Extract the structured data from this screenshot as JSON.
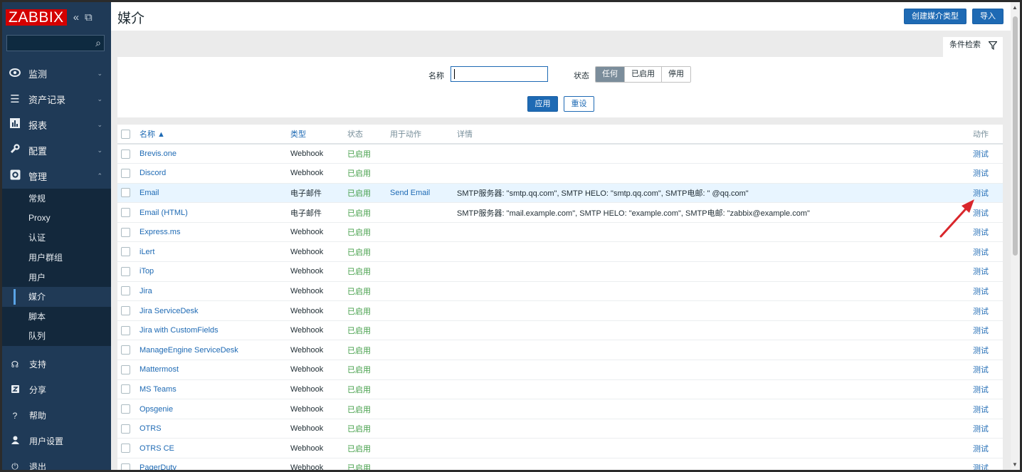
{
  "sidebar": {
    "logo": "ZABBIX",
    "collapse_icon": "«",
    "kiosk_icon": "⧉",
    "menu": [
      {
        "label": "监测",
        "icon": "👁"
      },
      {
        "label": "资产记录",
        "icon": "☰"
      },
      {
        "label": "报表",
        "icon": "▥"
      },
      {
        "label": "配置",
        "icon": "🔧"
      },
      {
        "label": "管理",
        "icon": "⚙"
      }
    ],
    "admin_submenu": [
      "常规",
      "Proxy",
      "认证",
      "用户群组",
      "用户",
      "媒介",
      "脚本",
      "队列"
    ],
    "active_submenu": "媒介",
    "bottom": [
      {
        "label": "支持",
        "icon": "?"
      },
      {
        "label": "分享",
        "icon": "Z"
      },
      {
        "label": "帮助",
        "icon": "?"
      },
      {
        "label": "用户设置",
        "icon": "👤"
      },
      {
        "label": "退出",
        "icon": "⏻"
      }
    ]
  },
  "header": {
    "title": "媒介",
    "create_button": "创建媒介类型",
    "import_button": "导入"
  },
  "filter": {
    "tab_label": "条件检索",
    "name_label": "名称",
    "name_value": "",
    "status_label": "状态",
    "status_options": [
      "任何",
      "已启用",
      "停用"
    ],
    "status_selected": "任何",
    "apply_button": "应用",
    "reset_button": "重设"
  },
  "table": {
    "headers": {
      "name": "名称 ▲",
      "type": "类型",
      "status": "状态",
      "used_in_actions": "用于动作",
      "details": "详情",
      "action": "动作"
    },
    "rows": [
      {
        "name": "Brevis.one",
        "type": "Webhook",
        "status": "已启用",
        "actions": "",
        "details": "",
        "test": "测试"
      },
      {
        "name": "Discord",
        "type": "Webhook",
        "status": "已启用",
        "actions": "",
        "details": "",
        "test": "测试"
      },
      {
        "name": "Email",
        "type": "电子邮件",
        "status": "已启用",
        "actions": "Send Email",
        "details": "SMTP服务器: \"smtp.qq.com\", SMTP HELO: \"smtp.qq.com\", SMTP电邮: \"          @qq.com\"",
        "test": "测试"
      },
      {
        "name": "Email (HTML)",
        "type": "电子邮件",
        "status": "已启用",
        "actions": "",
        "details": "SMTP服务器: \"mail.example.com\", SMTP HELO: \"example.com\", SMTP电邮: \"zabbix@example.com\"",
        "test": "测试"
      },
      {
        "name": "Express.ms",
        "type": "Webhook",
        "status": "已启用",
        "actions": "",
        "details": "",
        "test": "测试"
      },
      {
        "name": "iLert",
        "type": "Webhook",
        "status": "已启用",
        "actions": "",
        "details": "",
        "test": "测试"
      },
      {
        "name": "iTop",
        "type": "Webhook",
        "status": "已启用",
        "actions": "",
        "details": "",
        "test": "测试"
      },
      {
        "name": "Jira",
        "type": "Webhook",
        "status": "已启用",
        "actions": "",
        "details": "",
        "test": "测试"
      },
      {
        "name": "Jira ServiceDesk",
        "type": "Webhook",
        "status": "已启用",
        "actions": "",
        "details": "",
        "test": "测试"
      },
      {
        "name": "Jira with CustomFields",
        "type": "Webhook",
        "status": "已启用",
        "actions": "",
        "details": "",
        "test": "测试"
      },
      {
        "name": "ManageEngine ServiceDesk",
        "type": "Webhook",
        "status": "已启用",
        "actions": "",
        "details": "",
        "test": "测试"
      },
      {
        "name": "Mattermost",
        "type": "Webhook",
        "status": "已启用",
        "actions": "",
        "details": "",
        "test": "测试"
      },
      {
        "name": "MS Teams",
        "type": "Webhook",
        "status": "已启用",
        "actions": "",
        "details": "",
        "test": "测试"
      },
      {
        "name": "Opsgenie",
        "type": "Webhook",
        "status": "已启用",
        "actions": "",
        "details": "",
        "test": "测试"
      },
      {
        "name": "OTRS",
        "type": "Webhook",
        "status": "已启用",
        "actions": "",
        "details": "",
        "test": "测试"
      },
      {
        "name": "OTRS CE",
        "type": "Webhook",
        "status": "已启用",
        "actions": "",
        "details": "",
        "test": "测试"
      },
      {
        "name": "PagerDuty",
        "type": "Webhook",
        "status": "已启用",
        "actions": "",
        "details": "",
        "test": "测试"
      }
    ],
    "highlighted_row": "Email"
  },
  "annotation": {
    "color": "#d9262b"
  }
}
